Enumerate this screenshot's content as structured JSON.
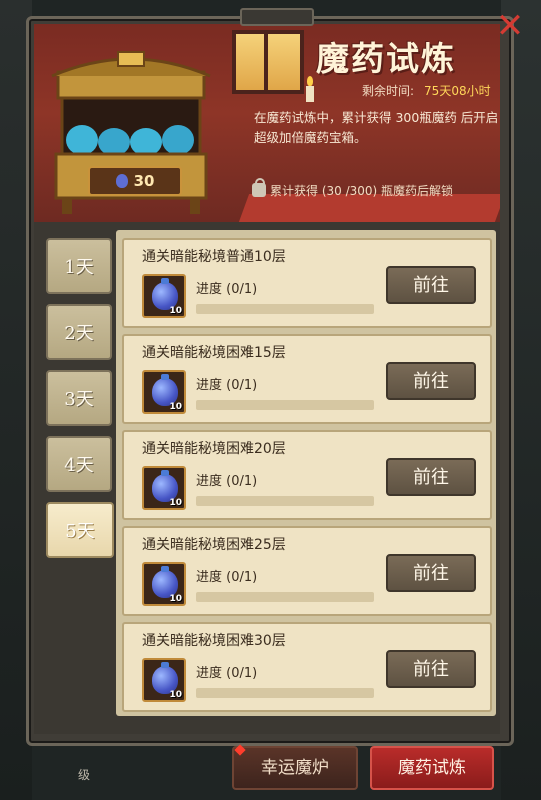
{
  "header": {
    "title": "魔药试炼",
    "remaining_label": "剩余时间:",
    "remaining_value": "75天08小时",
    "description": "在魔药试炼中，累计获得 300瓶魔药 后开启 超级加倍魔药宝箱。",
    "unlock_text": "累计获得 (30 /300) 瓶魔药后解锁"
  },
  "chest": {
    "count": "30"
  },
  "day_tabs": [
    "1天",
    "2天",
    "3天",
    "4天",
    "5天"
  ],
  "active_day": "5天",
  "tasks": [
    {
      "title": "通关暗能秘境普通10层",
      "progress_label": "进度 (0/1)",
      "progress": 0,
      "reward_count": "10",
      "button": "前往"
    },
    {
      "title": "通关暗能秘境困难15层",
      "progress_label": "进度 (0/1)",
      "progress": 0,
      "reward_count": "10",
      "button": "前往"
    },
    {
      "title": "通关暗能秘境困难20层",
      "progress_label": "进度 (0/1)",
      "progress": 0,
      "reward_count": "10",
      "button": "前往"
    },
    {
      "title": "通关暗能秘境困难25层",
      "progress_label": "进度 (0/1)",
      "progress": 0,
      "reward_count": "10",
      "button": "前往"
    },
    {
      "title": "通关暗能秘境困难30层",
      "progress_label": "进度 (0/1)",
      "progress": 0,
      "reward_count": "10",
      "button": "前往"
    }
  ],
  "bottom_tabs": {
    "lucky": "幸运魔炉",
    "trial": "魔药试炼"
  },
  "bottom_left": "级",
  "icons": {
    "close": "close-icon",
    "lock": "lock-icon",
    "potion": "potion-icon",
    "chest": "treasure-chest-icon"
  },
  "colors": {
    "accent_red": "#b92c2a",
    "banner": "#8e3527",
    "gold": "#ffd75a"
  }
}
